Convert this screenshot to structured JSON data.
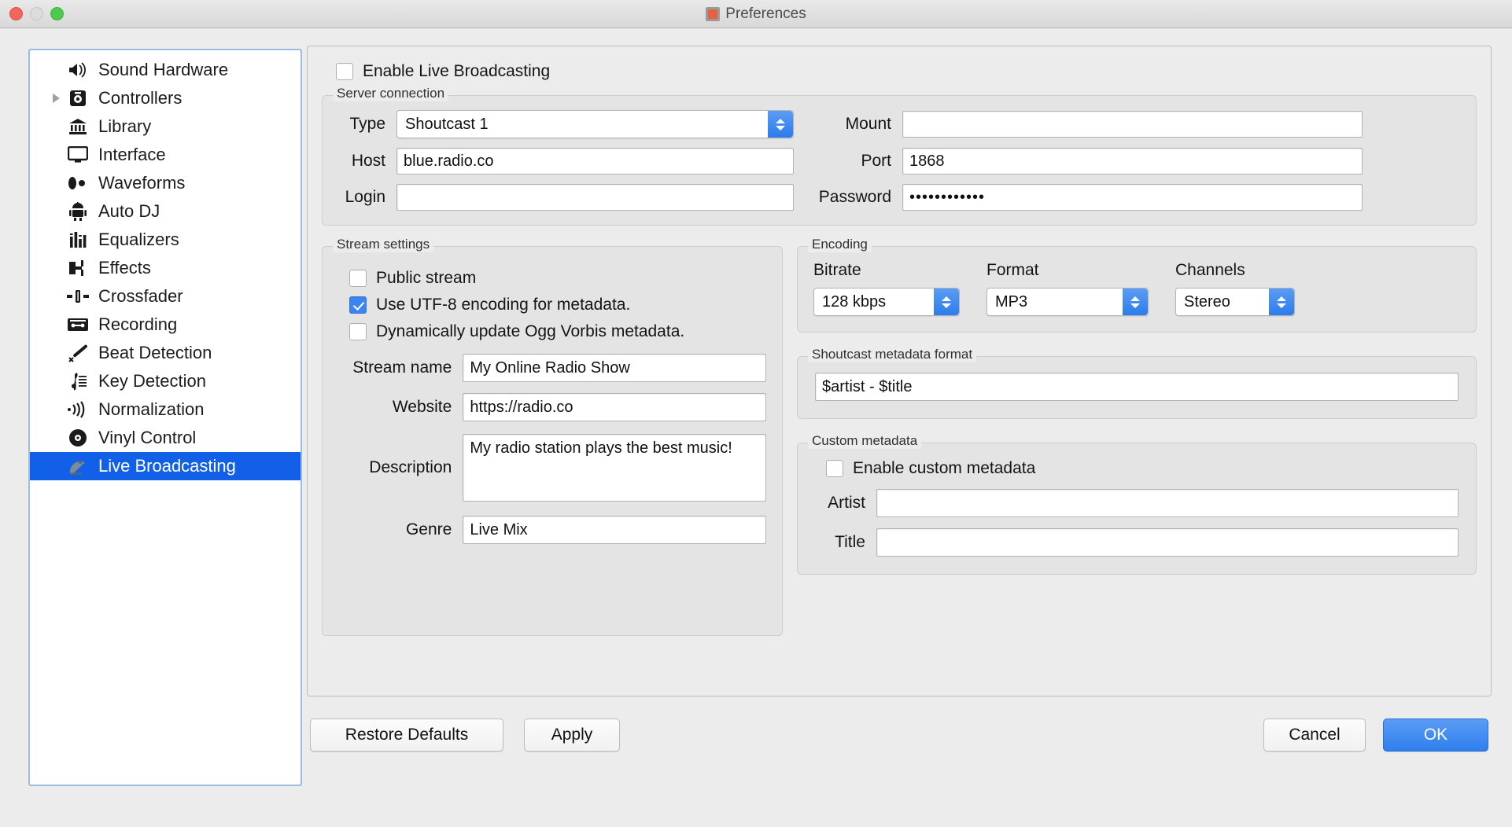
{
  "window": {
    "title": "Preferences",
    "icon": "app-icon",
    "traffic": [
      "close",
      "minimize",
      "zoom"
    ]
  },
  "sidebar": {
    "items": [
      {
        "label": "Sound Hardware",
        "icon": "speaker-icon",
        "expandable": false,
        "selected": false
      },
      {
        "label": "Controllers",
        "icon": "controller-icon",
        "expandable": true,
        "selected": false
      },
      {
        "label": "Library",
        "icon": "library-icon",
        "expandable": false,
        "selected": false
      },
      {
        "label": "Interface",
        "icon": "monitor-icon",
        "expandable": false,
        "selected": false
      },
      {
        "label": "Waveforms",
        "icon": "waveform-icon",
        "expandable": false,
        "selected": false
      },
      {
        "label": "Auto DJ",
        "icon": "robot-icon",
        "expandable": false,
        "selected": false
      },
      {
        "label": "Equalizers",
        "icon": "equalizer-icon",
        "expandable": false,
        "selected": false
      },
      {
        "label": "Effects",
        "icon": "effects-icon",
        "expandable": false,
        "selected": false
      },
      {
        "label": "Crossfader",
        "icon": "crossfader-icon",
        "expandable": false,
        "selected": false
      },
      {
        "label": "Recording",
        "icon": "cassette-icon",
        "expandable": false,
        "selected": false
      },
      {
        "label": "Beat Detection",
        "icon": "drumstick-icon",
        "expandable": false,
        "selected": false
      },
      {
        "label": "Key Detection",
        "icon": "music-key-icon",
        "expandable": false,
        "selected": false
      },
      {
        "label": "Normalization",
        "icon": "volume-waves-icon",
        "expandable": false,
        "selected": false
      },
      {
        "label": "Vinyl Control",
        "icon": "vinyl-icon",
        "expandable": false,
        "selected": false
      },
      {
        "label": "Live Broadcasting",
        "icon": "satellite-dish-icon",
        "expandable": false,
        "selected": true
      }
    ]
  },
  "main": {
    "enable_live_broadcasting": {
      "label": "Enable Live Broadcasting",
      "checked": false
    },
    "server_connection": {
      "legend": "Server connection",
      "type": {
        "label": "Type",
        "value": "Shoutcast 1"
      },
      "mount": {
        "label": "Mount",
        "value": "",
        "placeholder": ""
      },
      "host": {
        "label": "Host",
        "value": "blue.radio.co",
        "placeholder": ""
      },
      "port": {
        "label": "Port",
        "value": "1868",
        "placeholder": ""
      },
      "login": {
        "label": "Login",
        "value": "",
        "placeholder": ""
      },
      "password": {
        "label": "Password",
        "value": "••••••••••••",
        "placeholder": ""
      }
    },
    "stream_settings": {
      "legend": "Stream settings",
      "public_stream": {
        "label": "Public stream",
        "checked": false
      },
      "utf8": {
        "label": "Use UTF-8 encoding for metadata.",
        "checked": true
      },
      "ogg_vorbis": {
        "label": "Dynamically update Ogg Vorbis metadata.",
        "checked": false
      },
      "stream_name": {
        "label": "Stream name",
        "value": "My Online Radio Show"
      },
      "website": {
        "label": "Website",
        "value": "https://radio.co"
      },
      "description": {
        "label": "Description",
        "value": "My radio station plays the best music!"
      },
      "genre": {
        "label": "Genre",
        "value": "Live Mix"
      }
    },
    "encoding": {
      "legend": "Encoding",
      "bitrate": {
        "label": "Bitrate",
        "value": "128 kbps"
      },
      "format": {
        "label": "Format",
        "value": "MP3"
      },
      "channels": {
        "label": "Channels",
        "value": "Stereo"
      }
    },
    "shoutcast_metadata": {
      "legend": "Shoutcast metadata format",
      "value": "$artist - $title"
    },
    "custom_metadata": {
      "legend": "Custom metadata",
      "enable": {
        "label": "Enable custom metadata",
        "checked": false
      },
      "artist": {
        "label": "Artist",
        "value": ""
      },
      "title": {
        "label": "Title",
        "value": ""
      }
    }
  },
  "footer": {
    "restore_defaults": "Restore Defaults",
    "apply": "Apply",
    "cancel": "Cancel",
    "ok": "OK"
  },
  "colors": {
    "selection": "#1260e8",
    "accent": "#2f7fee",
    "checkbox_checked": "#3c85f0"
  }
}
